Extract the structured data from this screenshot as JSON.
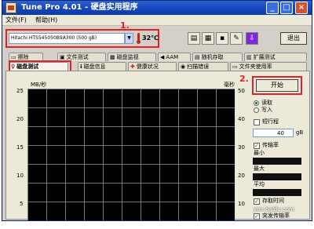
{
  "window": {
    "title": "Tune Pro 4.01 - 硬盘实用程序",
    "minimize": "_",
    "maximize": "□",
    "close": "×"
  },
  "menu": [
    "文件(F)",
    "帮助(H)"
  ],
  "drive": {
    "selected": "Hitachi HTS545050B9A300 (500 gB)",
    "temperature": "32℃"
  },
  "toolbar_icons": [
    "copy-info-icon",
    "copy-screen-icon",
    "save-icon",
    "options-icon",
    "download-icon"
  ],
  "exit_label": "退出",
  "markers": {
    "one": "1.",
    "two": "2."
  },
  "tabs_row1": [
    {
      "label": "擦除",
      "icon": "eraser-icon"
    },
    {
      "label": "文件测试",
      "icon": "file-test-icon"
    },
    {
      "label": "磁盘监视",
      "icon": "monitor-icon"
    },
    {
      "label": "AAM",
      "icon": "speaker-icon"
    },
    {
      "label": "随机存取",
      "icon": "random-access-icon"
    },
    {
      "label": "扩展测试",
      "icon": "extra-tests-icon"
    }
  ],
  "tabs_row2": [
    {
      "label": "磁盘测试",
      "icon": "benchmark-icon"
    },
    {
      "label": "磁盘信息",
      "icon": "info-icon"
    },
    {
      "label": "健康状况",
      "icon": "health-icon"
    },
    {
      "label": "扫描错误",
      "icon": "scan-icon"
    },
    {
      "label": "文件夹使用率",
      "icon": "folder-usage-icon"
    }
  ],
  "graph": {
    "left_unit": "MB/秒",
    "right_unit": "毫秒",
    "left_ticks": [
      "25",
      "20",
      "15",
      "10",
      "5"
    ],
    "right_ticks": [
      "50",
      "40",
      "30",
      "20",
      "10"
    ]
  },
  "side": {
    "start_label": "开始",
    "read_label": "读取",
    "write_label": "写入",
    "short_test_label": "短行程",
    "short_test_value": "40",
    "short_test_unit": "gB",
    "transfer_rate_label": "传输率",
    "min_label": "最小",
    "max_label": "最大",
    "avg_label": "平均",
    "access_time_label": "存取时间",
    "burst_rate_label": "突发传输率"
  },
  "watermark": "yan.baidu.com"
}
